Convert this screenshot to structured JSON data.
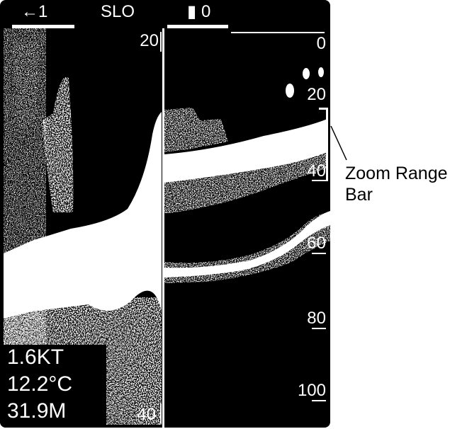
{
  "header": {
    "left_indicator": "←1",
    "mode": "SLO",
    "right_indicator": "0"
  },
  "zoom_pane": {
    "range_top": "20",
    "range_bottom": "40"
  },
  "depth_scale": [
    "0",
    "20",
    "40",
    "60",
    "80",
    "100"
  ],
  "readouts": {
    "speed": "1.6KT",
    "temperature": "12.2°C",
    "depth": "31.9M"
  },
  "annotation": {
    "line1": "Zoom Range",
    "line2": "Bar"
  }
}
